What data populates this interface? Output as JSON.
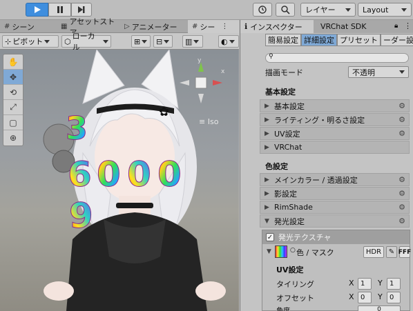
{
  "toolbar": {
    "play_icon": "play-icon",
    "pause_icon": "pause-icon",
    "step_icon": "step-icon",
    "history_icon": "history-icon",
    "search_icon": "search-icon",
    "layers_label": "レイヤー",
    "layout_label": "Layout"
  },
  "scene_tabs": [
    {
      "icon": "#",
      "label": "シーン"
    },
    {
      "icon": "▦",
      "label": "アセットストア"
    },
    {
      "icon": "▷",
      "label": "アニメーター"
    },
    {
      "icon": "#",
      "label": "シー"
    }
  ],
  "scene_toolbar": {
    "pivot_label": "ピボット",
    "local_label": "ローカル"
  },
  "viewport": {
    "iso_label": "Iso"
  },
  "inspector": {
    "tabs": [
      {
        "icon": "ℹ",
        "label": "インスペクター"
      },
      {
        "label": "VRChat SDK"
      }
    ],
    "subtabs": [
      "簡易設定",
      "詳細設定",
      "プリセット",
      "ーダー設"
    ],
    "active_subtab": "詳細設定",
    "search_placeholder": "",
    "render_mode_label": "描画モード",
    "render_mode_value": "不透明",
    "basic_header": "基本設定",
    "basic_sections": [
      "基本設定",
      "ライティング・明るさ設定",
      "UV設定",
      "VRChat"
    ],
    "color_header": "色設定",
    "color_sections": [
      "メインカラー / 透過設定",
      "影設定",
      "RimShade",
      "発光設定"
    ],
    "emission": {
      "title": "発光テクスチャ",
      "color_mask_label": "色 / マスク",
      "hdr_label": "HDR",
      "fff_label": "FFF",
      "uv_header": "UV設定",
      "tiling_label": "タイリング",
      "offset_label": "オフセット",
      "angle_label": "角度",
      "tiling_x": "1",
      "tiling_y": "1",
      "offset_x": "0",
      "offset_y": "0",
      "angle_value": "0",
      "x_label": "X",
      "y_label": "Y"
    }
  },
  "colors": {
    "accent": "#3f8ede",
    "selected_tab": "#7fa9d6",
    "panel_bg": "#c4c4c4"
  }
}
